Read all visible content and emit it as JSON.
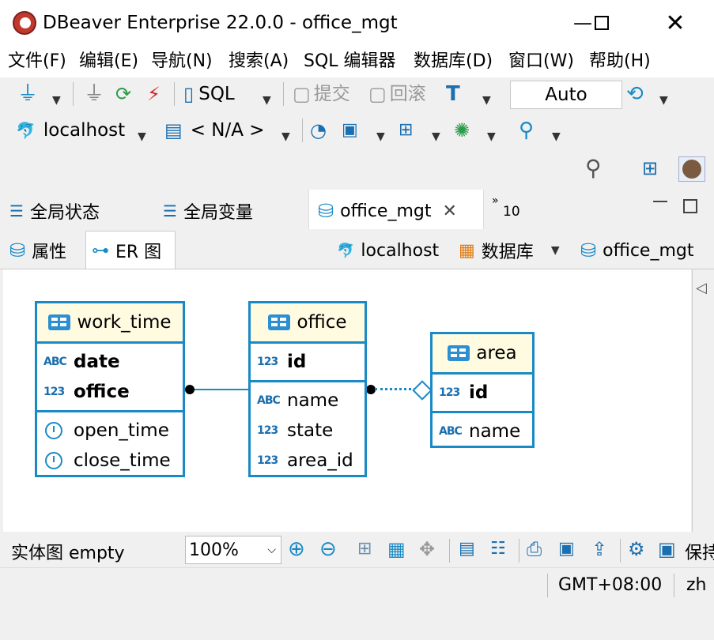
{
  "window": {
    "title": "DBeaver Enterprise 22.0.0 - office_mgt"
  },
  "menu": [
    "文件(F)",
    "编辑(E)",
    "导航(N)",
    "搜索(A)",
    "SQL 编辑器",
    "数据库(D)",
    "窗口(W)",
    "帮助(H)"
  ],
  "toolbar": {
    "sql_label": "SQL",
    "commit_label": "提交",
    "rollback_label": "回滚",
    "transaction_mode": "Auto",
    "datasource": "localhost",
    "schema": "< N/A >"
  },
  "tabs": {
    "global_status": "全局状态",
    "global_vars": "全局变量",
    "active": "office_mgt",
    "overflow_count": "10"
  },
  "subtabs": {
    "properties": "属性",
    "er": "ER 图",
    "crumb_host": "localhost",
    "crumb_db": "数据库",
    "crumb_schema": "office_mgt"
  },
  "entities": {
    "work_time": {
      "name": "work_time",
      "keys": [
        {
          "type": "ABC",
          "name": "date"
        },
        {
          "type": "123",
          "name": "office"
        }
      ],
      "cols": [
        {
          "type": "clock",
          "name": "open_time"
        },
        {
          "type": "clock",
          "name": "close_time"
        }
      ]
    },
    "office": {
      "name": "office",
      "keys": [
        {
          "type": "123",
          "name": "id"
        }
      ],
      "cols": [
        {
          "type": "ABC",
          "name": "name"
        },
        {
          "type": "123",
          "name": "state"
        },
        {
          "type": "123",
          "name": "area_id"
        }
      ]
    },
    "area": {
      "name": "area",
      "keys": [
        {
          "type": "123",
          "name": "id"
        }
      ],
      "cols": [
        {
          "type": "ABC",
          "name": "name"
        }
      ]
    }
  },
  "status": {
    "diagram_label": "实体图 empty",
    "zoom": "100%",
    "save_label": "保持",
    "timezone": "GMT+08:00",
    "locale": "zh"
  },
  "colors": {
    "accent": "#1a8ac6",
    "header_bg": "#fffbe0"
  }
}
